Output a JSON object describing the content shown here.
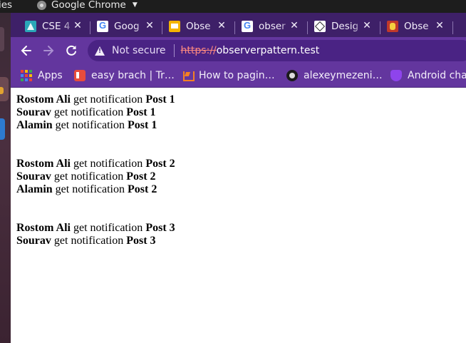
{
  "top_panel": {
    "activities_label": "ies",
    "app_name": "Google Chrome"
  },
  "tabs": [
    {
      "label": "CSE 4",
      "icon": "classroom-icon"
    },
    {
      "label": "Goog",
      "icon": "google-icon"
    },
    {
      "label": "Obse",
      "icon": "slides-icon"
    },
    {
      "label": "obser",
      "icon": "google-icon"
    },
    {
      "label": "Desig",
      "icon": "design-patterns-icon"
    },
    {
      "label": "Obse",
      "icon": "observer-icon"
    }
  ],
  "omnibox": {
    "security_label": "Not secure",
    "scheme": "https://",
    "host": "observerpattern.test"
  },
  "bookmarks": [
    {
      "label": "Apps",
      "icon": "apps-grid-icon"
    },
    {
      "label": "easy brach | Tr…",
      "icon": "trello-icon"
    },
    {
      "label": "How to pagin…",
      "icon": "stackoverflow-icon"
    },
    {
      "label": "alexeymezeni…",
      "icon": "github-icon"
    },
    {
      "label": "Android cha",
      "icon": "android-icon"
    }
  ],
  "notifications": [
    {
      "post": "Post 1",
      "entries": [
        {
          "user": "Rostom Ali",
          "text": " get notification "
        },
        {
          "user": "Sourav",
          "text": " get notification "
        },
        {
          "user": "Alamin",
          "text": " get notification "
        }
      ]
    },
    {
      "post": "Post 2",
      "entries": [
        {
          "user": "Rostom Ali",
          "text": " get notification "
        },
        {
          "user": "Sourav",
          "text": " get notification "
        },
        {
          "user": "Alamin",
          "text": " get notification "
        }
      ]
    },
    {
      "post": "Post 3",
      "entries": [
        {
          "user": "Rostom Ali",
          "text": " get notification "
        },
        {
          "user": "Sourav",
          "text": " get notification "
        }
      ]
    }
  ],
  "colors": {
    "tabstrip": "#3e2068",
    "toolbar": "#63369e",
    "omnibox": "#4a2384"
  }
}
